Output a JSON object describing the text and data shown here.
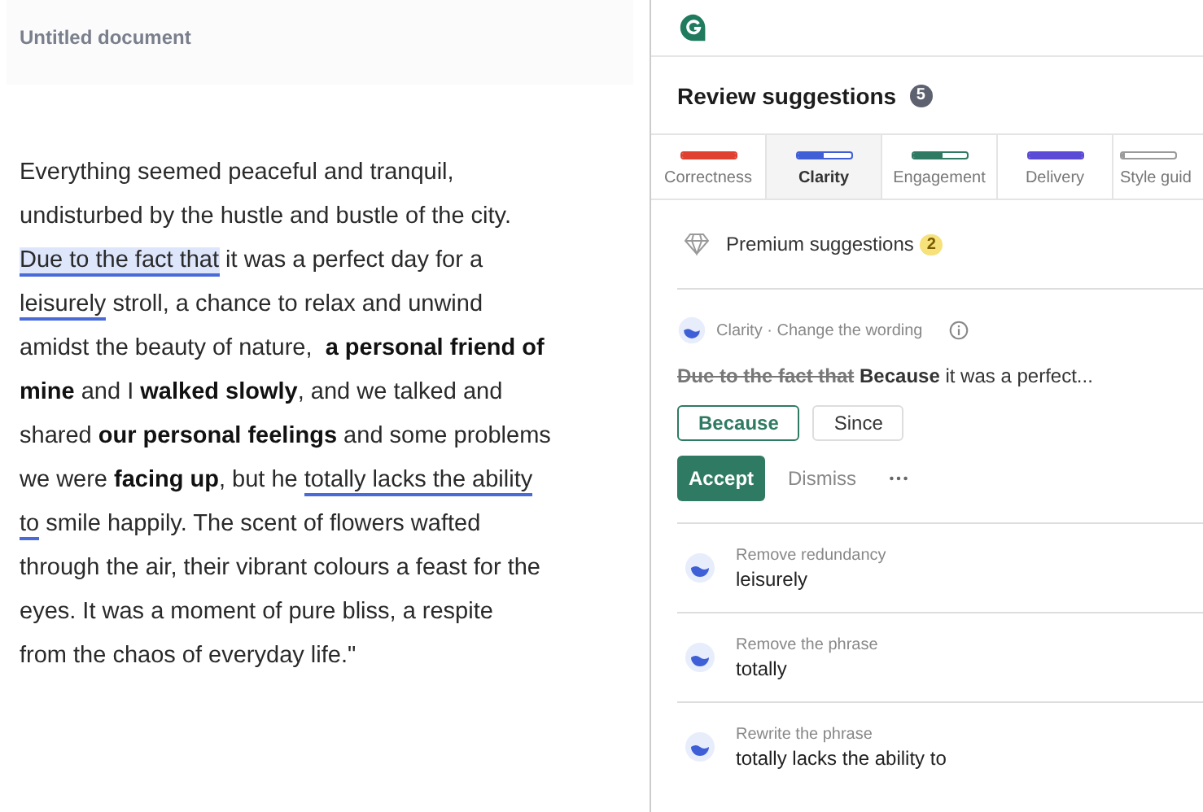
{
  "document": {
    "title": "Untitled document",
    "lines": [
      [
        {
          "text": "Everything seemed peaceful and tranquil,"
        }
      ],
      [
        {
          "text": "undisturbed by the hustle and bustle of the city."
        }
      ],
      [
        {
          "text": "Due to the fact that",
          "highlighted": true,
          "underlined": true
        },
        {
          "text": " it was a perfect day for a"
        }
      ],
      [
        {
          "text": "leisurely",
          "underlined": true
        },
        {
          "text": " stroll, a chance to relax and unwind"
        }
      ],
      [
        {
          "text": "amidst the beauty of nature,  "
        },
        {
          "text": "a personal friend of",
          "bold": true
        }
      ],
      [
        {
          "text": "mine",
          "bold": true
        },
        {
          "text": " and I "
        },
        {
          "text": "walked slowly",
          "bold": true
        },
        {
          "text": ", and we talked and"
        }
      ],
      [
        {
          "text": "shared "
        },
        {
          "text": "our personal feelings",
          "bold": true
        },
        {
          "text": " and some problems"
        }
      ],
      [
        {
          "text": "we were "
        },
        {
          "text": "facing up",
          "bold": true
        },
        {
          "text": ", but he "
        },
        {
          "text": "totally lacks the ability",
          "underlined": true
        }
      ],
      [
        {
          "text": "to",
          "underlined": true
        },
        {
          "text": " smile happily. The scent of flowers wafted"
        }
      ],
      [
        {
          "text": "through the air, their vibrant colours a feast for the"
        }
      ],
      [
        {
          "text": "eyes. It was a moment of pure bliss, a respite"
        }
      ],
      [
        {
          "text": "from the chaos of everyday life.\""
        }
      ]
    ]
  },
  "panel": {
    "heading": "Review suggestions",
    "count": "5",
    "tabs": [
      {
        "label": "Correctness",
        "color": "#e0402f",
        "level": 1,
        "selected": false
      },
      {
        "label": "Clarity",
        "color": "#3f5fd6",
        "level": 0.5,
        "selected": true
      },
      {
        "label": "Engagement",
        "color": "#2f7a62",
        "level": 0.55,
        "selected": false
      },
      {
        "label": "Delivery",
        "color": "#5a4ad6",
        "level": 1,
        "selected": false
      },
      {
        "label": "Style guid",
        "color": "#9a9a9a",
        "level": 0,
        "selected": false
      }
    ],
    "premium": {
      "label": "Premium suggestions",
      "count": "2"
    },
    "active": {
      "category": "Clarity · Change the wording",
      "removed": "Due to the fact that",
      "inserted": "Because",
      "rest": " it was a perfect...",
      "options": [
        {
          "label": "Because",
          "selected": true
        },
        {
          "label": "Since",
          "selected": false
        }
      ],
      "accept": "Accept",
      "dismiss": "Dismiss"
    },
    "collapsed": [
      {
        "title": "Remove redundancy",
        "text": "leisurely"
      },
      {
        "title": "Remove the phrase",
        "text": "totally"
      },
      {
        "title": "Rewrite the phrase",
        "text": "totally lacks the ability to"
      }
    ]
  }
}
